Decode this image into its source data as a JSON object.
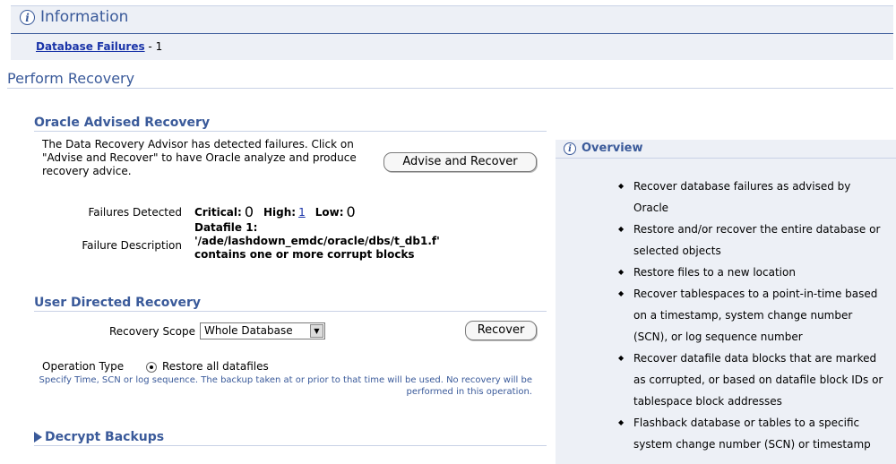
{
  "information": {
    "title": "Information",
    "link_label": "Database Failures",
    "link_suffix": " - 1"
  },
  "perform_recovery": {
    "title": "Perform Recovery"
  },
  "oracle_advised": {
    "title": "Oracle Advised Recovery",
    "description": "The Data Recovery Advisor has detected failures. Click on \"Advise and Recover\" to have Oracle analyze and produce recovery advice.",
    "advise_button": "Advise and Recover",
    "failures_detected_label": "Failures Detected",
    "critical_label": "Critical:",
    "critical_value": "0",
    "high_label": "High:",
    "high_value": "1",
    "low_label": "Low:",
    "low_value": "0",
    "failure_description_label": "Failure Description",
    "failure_description": "Datafile 1: '/ade/lashdown_emdc/oracle/dbs/t_db1.f' contains one or more corrupt blocks"
  },
  "user_directed": {
    "title": "User Directed Recovery",
    "recovery_scope_label": "Recovery Scope",
    "recovery_scope_value": "Whole Database",
    "recover_button": "Recover",
    "operation_type_label": "Operation Type",
    "radio_label": "Restore all datafiles",
    "radio_hint": "Specify Time, SCN or log sequence. The backup taken at or prior to that time will be used. No recovery will be performed in this operation."
  },
  "decrypt": {
    "title": "Decrypt Backups"
  },
  "overview": {
    "title": "Overview",
    "items": [
      "Recover database failures as advised by Oracle",
      "Restore and/or recover the entire database or selected objects",
      "Restore files to a new location",
      "Recover tablespaces to a point-in-time based on a timestamp, system change number (SCN), or log sequence number",
      "Recover datafile data blocks that are marked as corrupted, or based on datafile block IDs or tablespace block addresses",
      "Flashback database or tables to a specific system change number (SCN) or timestamp"
    ]
  },
  "icons": {
    "info": "info-icon",
    "overview": "info-icon",
    "decrypt": "triangle-right-icon",
    "select": "chevron-down-icon"
  }
}
